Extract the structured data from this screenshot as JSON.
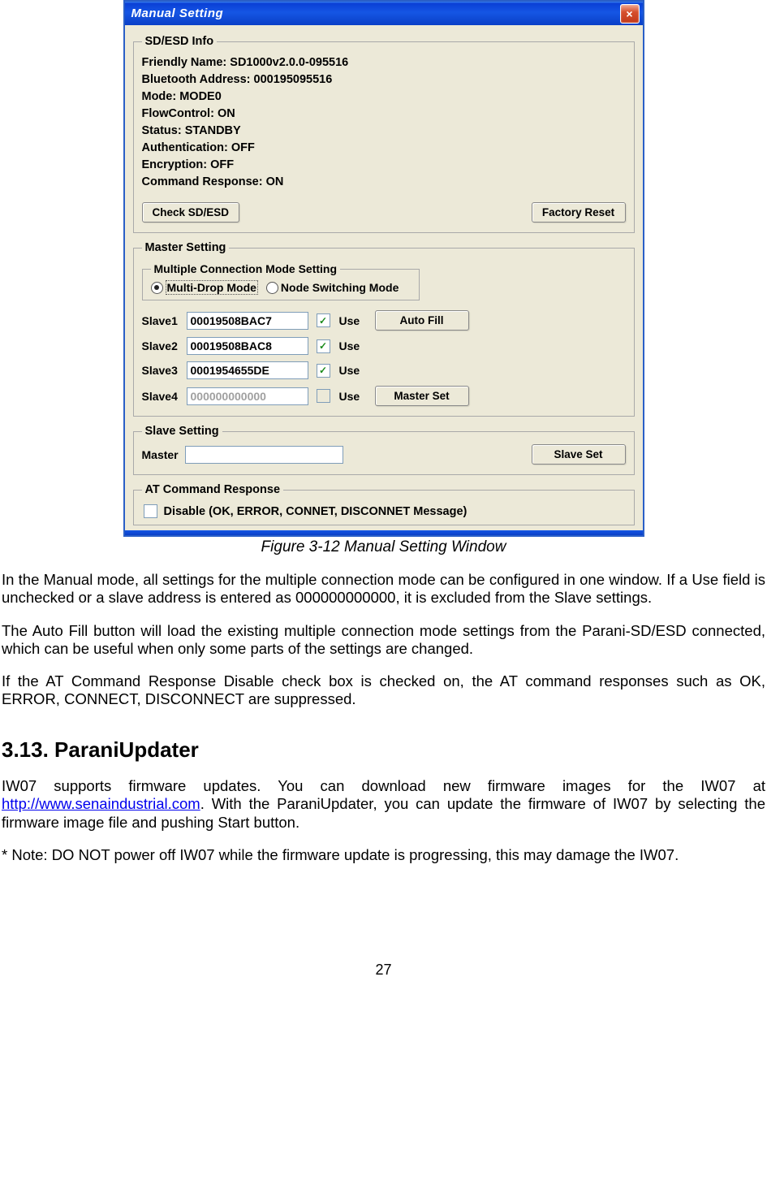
{
  "dialog": {
    "title": "Manual Setting",
    "close_icon": "×",
    "sd_info": {
      "legend": "SD/ESD Info",
      "friendly_name_label": "Friendly Name:",
      "friendly_name_value": "SD1000v2.0.0-095516",
      "bt_addr_label": "Bluetooth Address:",
      "bt_addr_value": "000195095516",
      "mode_label": "Mode:",
      "mode_value": "MODE0",
      "flow_label": "FlowControl:",
      "flow_value": "ON",
      "status_label": "Status:",
      "status_value": "STANDBY",
      "auth_label": "Authentication:",
      "auth_value": "OFF",
      "enc_label": "Encryption:",
      "enc_value": "OFF",
      "cmd_label": "Command Response:",
      "cmd_value": "ON",
      "check_btn": "Check SD/ESD",
      "reset_btn": "Factory Reset"
    },
    "master": {
      "legend": "Master Setting",
      "mode_legend": "Multiple Connection Mode Setting",
      "radio1": "Multi-Drop Mode",
      "radio2": "Node Switching Mode",
      "radio_selected": 1,
      "use_label": "Use",
      "autofill_btn": "Auto Fill",
      "masterset_btn": "Master Set",
      "slaves": [
        {
          "label": "Slave1",
          "value": "00019508BAC7",
          "checked": true,
          "enabled": true
        },
        {
          "label": "Slave2",
          "value": "00019508BAC8",
          "checked": true,
          "enabled": true
        },
        {
          "label": "Slave3",
          "value": "0001954655DE",
          "checked": true,
          "enabled": true
        },
        {
          "label": "Slave4",
          "value": "000000000000",
          "checked": false,
          "enabled": false
        }
      ]
    },
    "slave": {
      "legend": "Slave Setting",
      "master_label": "Master",
      "master_value": "",
      "slaveset_btn": "Slave Set"
    },
    "at": {
      "legend": "AT Command Response",
      "disable_label": "Disable (OK, ERROR, CONNET, DISCONNET Message)",
      "disable_checked": false
    }
  },
  "doc": {
    "caption": "Figure 3-12 Manual Setting Window",
    "para1": "In the Manual mode, all settings for the multiple connection mode can be configured in one window. If a Use field is unchecked or a slave address is entered as 000000000000, it is excluded from the Slave settings.",
    "para2": "The Auto Fill button will load the existing multiple connection mode settings from the Parani-SD/ESD connected, which can be useful when only some parts of the settings are changed.",
    "para3": "If the AT Command Response Disable check box is checked on, the AT command responses such as OK, ERROR, CONNECT, DISCONNECT are suppressed.",
    "heading": "3.13. ParaniUpdater",
    "para4a": "IW07 supports firmware updates. You can download new firmware images for the IW07 at ",
    "link_text": "http://www.senaindustrial.com",
    "para4b": ". With the ParaniUpdater, you can update the firmware of IW07 by selecting the firmware image file and pushing Start button.",
    "para5": "* Note: DO NOT power off IW07 while the firmware update is progressing, this may damage the IW07.",
    "page_number": "27"
  }
}
